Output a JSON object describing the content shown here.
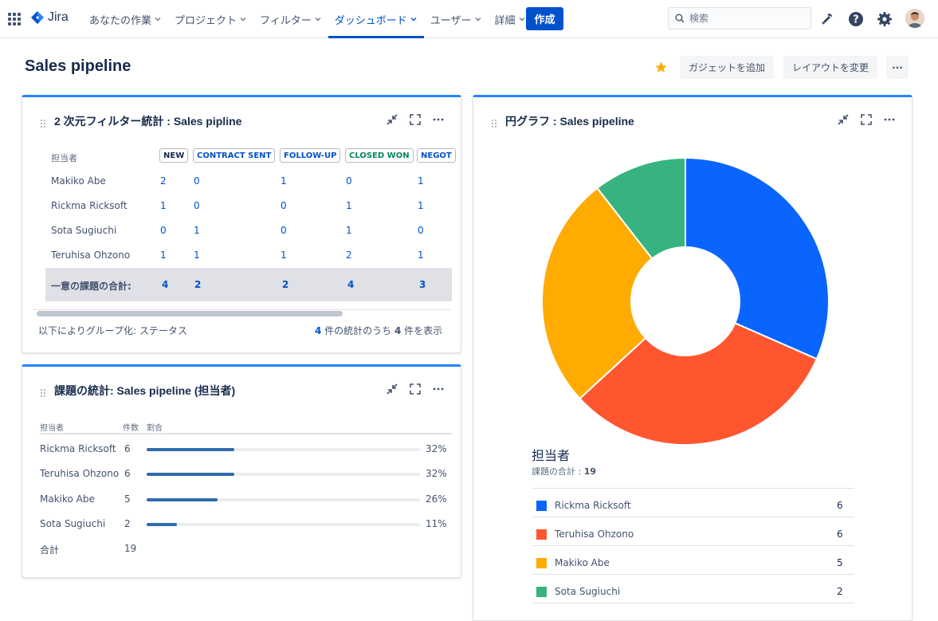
{
  "app": {
    "logo_text": "Jira"
  },
  "nav": [
    {
      "label": "あなたの作業",
      "dropdown": true
    },
    {
      "label": "プロジェクト",
      "dropdown": true
    },
    {
      "label": "フィルター",
      "dropdown": true
    },
    {
      "label": "ダッシュボード",
      "dropdown": true,
      "active": true
    },
    {
      "label": "ユーザー",
      "dropdown": true
    },
    {
      "label": "詳細",
      "dropdown": true
    }
  ],
  "create_label": "作成",
  "search": {
    "placeholder": "検索"
  },
  "page": {
    "title": "Sales pipeline",
    "add_gadget": "ガジェットを追加",
    "change_layout": "レイアウトを変更",
    "more": "···"
  },
  "two_d": {
    "title": "2 次元フィルター統計 : Sales pipline",
    "row_header": "担当者",
    "columns": [
      {
        "label": "NEW",
        "color": "#172b4d"
      },
      {
        "label": "CONTRACT SENT",
        "color": "#0052cc"
      },
      {
        "label": "FOLLOW-UP",
        "color": "#0052cc"
      },
      {
        "label": "CLOSED WON",
        "color": "#00875a"
      },
      {
        "label": "NEGOT",
        "color": "#0052cc"
      }
    ],
    "rows": [
      {
        "name": "Makiko Abe",
        "values": [
          "2",
          "0",
          "1",
          "0",
          "1"
        ]
      },
      {
        "name": "Rickma Ricksoft",
        "values": [
          "1",
          "0",
          "0",
          "1",
          "1"
        ]
      },
      {
        "name": "Sota Sugiuchi",
        "values": [
          "0",
          "1",
          "0",
          "1",
          "0"
        ]
      },
      {
        "name": "Teruhisa Ohzono",
        "values": [
          "1",
          "1",
          "1",
          "2",
          "1"
        ]
      }
    ],
    "total_label": "一意の課題の合計:",
    "totals": [
      "4",
      "2",
      "2",
      "4",
      "3"
    ],
    "footer_left": "以下によりグループ化: ステータス",
    "footer_count_a": "4",
    "footer_text_a": " 件の統計のうち ",
    "footer_count_b": "4",
    "footer_text_b": " 件を表示"
  },
  "stats": {
    "title": "課題の統計: Sales pipeline (担当者)",
    "col_name": "担当者",
    "col_count": "件数",
    "col_ratio": "割合",
    "rows": [
      {
        "name": "Rickma Ricksoft",
        "count": "6",
        "pct": "32%",
        "fraction": 0.32
      },
      {
        "name": "Teruhisa Ohzono",
        "count": "6",
        "pct": "32%",
        "fraction": 0.32
      },
      {
        "name": "Makiko Abe",
        "count": "5",
        "pct": "26%",
        "fraction": 0.26
      },
      {
        "name": "Sota Sugiuchi",
        "count": "2",
        "pct": "11%",
        "fraction": 0.11
      }
    ],
    "total_label": "合計",
    "total_value": "19"
  },
  "pie": {
    "title": "円グラフ : Sales pipeline",
    "legend_title": "担当者",
    "total_label": "課題の合計 : ",
    "total_value": "19"
  },
  "chart_data": {
    "type": "pie",
    "donut": true,
    "categories": [
      "Rickma Ricksoft",
      "Teruhisa Ohzono",
      "Makiko Abe",
      "Sota Sugiuchi"
    ],
    "values": [
      6,
      6,
      5,
      2
    ],
    "value_labels": [
      "6",
      "6",
      "5",
      "2"
    ],
    "colors": [
      "#0a65ff",
      "#ff5630",
      "#ffab00",
      "#36b37e"
    ],
    "title": "担当者",
    "legend_placement": "bottom"
  }
}
